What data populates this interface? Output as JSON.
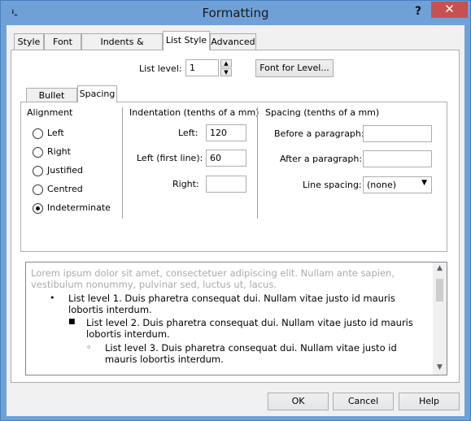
{
  "window": {
    "title": "Formatting",
    "help_glyph": "?",
    "close_glyph": "✕",
    "icon_glyph": "ᵢꞈ"
  },
  "main_tabs": [
    "Style",
    "Font",
    "Indents & Spacing",
    "List Style",
    "Advanced"
  ],
  "list_level": {
    "label": "List level:",
    "value": "1",
    "font_button": "Font for Level..."
  },
  "sub_tabs": [
    "Bullet style",
    "Spacing"
  ],
  "alignment": {
    "title": "Alignment",
    "options": [
      "Left",
      "Right",
      "Justified",
      "Centred",
      "Indeterminate"
    ],
    "selected": "Indeterminate"
  },
  "indentation": {
    "title": "Indentation (tenths of a mm)",
    "left_label": "Left:",
    "left_value": "120",
    "first_line_label": "Left (first line):",
    "first_line_value": "60",
    "right_label": "Right:",
    "right_value": ""
  },
  "spacing": {
    "title": "Spacing (tenths of a mm)",
    "before_label": "Before a paragraph:",
    "before_value": "",
    "after_label": "After a paragraph:",
    "after_value": "",
    "line_label": "Line spacing:",
    "line_value": "(none)"
  },
  "preview": {
    "placeholder": "Lorem ipsum dolor sit amet, consectetuer adipiscing elit. Nullam ante sapien, vestibulum nonummy, pulvinar sed, luctus ut, lacus.",
    "levels": [
      {
        "bullet": "•",
        "text": "List level 1. Duis pharetra consequat dui. Nullam vitae justo id mauris lobortis interdum."
      },
      {
        "bullet": "■",
        "text": "List level 2. Duis pharetra consequat dui. Nullam vitae justo id mauris lobortis interdum."
      },
      {
        "bullet": "◦",
        "text": "List level 3. Duis pharetra consequat dui. Nullam vitae justo id mauris lobortis interdum."
      }
    ]
  },
  "buttons": {
    "ok": "OK",
    "cancel": "Cancel",
    "help": "Help"
  }
}
